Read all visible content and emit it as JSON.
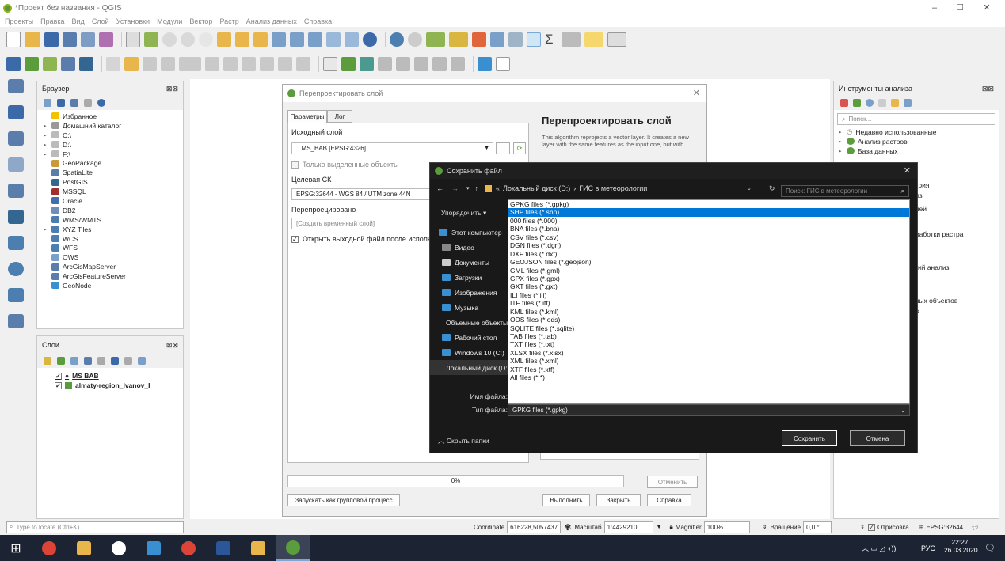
{
  "window": {
    "title": "*Проект без названия - QGIS",
    "min": "–",
    "max": "☐",
    "close": "✕"
  },
  "menu": [
    "Проекты",
    "Правка",
    "Вид",
    "Слой",
    "Установки",
    "Модули",
    "Вектор",
    "Растр",
    "Анализ данных",
    "Справка"
  ],
  "browser": {
    "title": "Браузер",
    "items": [
      {
        "label": "Избранное",
        "icon": "star-icon",
        "color": "#f2c200",
        "arrow": ""
      },
      {
        "label": "Домашний каталог",
        "icon": "home-folder-icon",
        "color": "#999",
        "arrow": "▸"
      },
      {
        "label": "C:\\",
        "icon": "folder-icon",
        "color": "#bbb",
        "arrow": "▸"
      },
      {
        "label": "D:\\",
        "icon": "folder-icon",
        "color": "#bbb",
        "arrow": "▸"
      },
      {
        "label": "F:\\",
        "icon": "folder-icon",
        "color": "#bbb",
        "arrow": "▸"
      },
      {
        "label": "GeoPackage",
        "icon": "geopackage-icon",
        "color": "#c79a3c",
        "arrow": ""
      },
      {
        "label": "SpatiaLite",
        "icon": "spatialite-icon",
        "color": "#5a7dac",
        "arrow": ""
      },
      {
        "label": "PostGIS",
        "icon": "postgis-icon",
        "color": "#336791",
        "arrow": ""
      },
      {
        "label": "MSSQL",
        "icon": "mssql-icon",
        "color": "#a03030",
        "arrow": ""
      },
      {
        "label": "Oracle",
        "icon": "oracle-icon",
        "color": "#3f6fad",
        "arrow": ""
      },
      {
        "label": "DB2",
        "icon": "db2-icon",
        "color": "#6f8fb8",
        "arrow": ""
      },
      {
        "label": "WMS/WMTS",
        "icon": "wms-icon",
        "color": "#4c7fb0",
        "arrow": ""
      },
      {
        "label": "XYZ Tiles",
        "icon": "xyz-icon",
        "color": "#4c7fb0",
        "arrow": "▸"
      },
      {
        "label": "WCS",
        "icon": "wcs-icon",
        "color": "#4c7fb0",
        "arrow": ""
      },
      {
        "label": "WFS",
        "icon": "wfs-icon",
        "color": "#4c7fb0",
        "arrow": ""
      },
      {
        "label": "OWS",
        "icon": "ows-icon",
        "color": "#7a9fc8",
        "arrow": ""
      },
      {
        "label": "ArcGisMapServer",
        "icon": "arcgis-map-icon",
        "color": "#5a7dac",
        "arrow": ""
      },
      {
        "label": "ArcGisFeatureServer",
        "icon": "arcgis-feature-icon",
        "color": "#5a7dac",
        "arrow": ""
      },
      {
        "label": "GeoNode",
        "icon": "geonode-icon",
        "color": "#3a8fd0",
        "arrow": ""
      }
    ]
  },
  "layers": {
    "title": "Слои",
    "items": [
      {
        "label": "MS BAB",
        "checked": "✓"
      },
      {
        "label": "almaty-region_Ivanov_I",
        "checked": "✓"
      }
    ]
  },
  "reproject": {
    "title": "Перепроектировать слой",
    "tabs": [
      "Параметры",
      "Лог"
    ],
    "input_label": "Исходный слой",
    "input_value": "MS_BAB [EPSG:4326]",
    "selected_only": "Только выделенные объекты",
    "target_label": "Целевая СК",
    "target_value": "EPSG:32644 - WGS 84 / UTM zone 44N",
    "output_label": "Перепроецировано",
    "output_value": "[Создать временный слой]",
    "open_after": "Открыть выходной файл после исполнен",
    "help_title": "Перепроектировать слой",
    "help_text": "This algorithm reprojects a vector layer. It creates a new layer with the same features as the input one, but with geometries reprojected to a new CRS.",
    "progress": "0%",
    "cancel": "Отменить",
    "batch": "Запускать как групповой процесс",
    "run": "Выполнить",
    "close": "Закрыть",
    "help": "Справка"
  },
  "save": {
    "title": "Сохранить файл",
    "path_prefix": "«",
    "path_drive": "Локальный диск (D:)",
    "path_folder": "ГИС в метеорологии",
    "search_placeholder": "Поиск: ГИС в метеорологии",
    "organize": "Упорядочить ▾",
    "nav": [
      {
        "label": "Этот компьютер",
        "color": "#3a8fd0"
      },
      {
        "label": "Видео",
        "color": "#888"
      },
      {
        "label": "Документы",
        "color": "#ccc"
      },
      {
        "label": "Загрузки",
        "color": "#3a8fd0"
      },
      {
        "label": "Изображения",
        "color": "#3a8fd0"
      },
      {
        "label": "Музыка",
        "color": "#3a8fd0"
      },
      {
        "label": "Объемные объекты",
        "color": "#3a8fd0"
      },
      {
        "label": "Рабочий стол",
        "color": "#3a8fd0"
      },
      {
        "label": "Windows 10 (C:)",
        "color": "#3a8fd0"
      },
      {
        "label": "Локальный диск (D:)",
        "color": "#888"
      }
    ],
    "filename_label": "Имя файла:",
    "filetype_label": "Тип файла:",
    "filetype_value": "GPKG files (*.gpkg)",
    "save": "Сохранить",
    "cancel": "Отмена",
    "hide": "Скрыть папки",
    "types": [
      "GPKG files (*.gpkg)",
      "SHP files (*.shp)",
      "000 files (*.000)",
      "BNA files (*.bna)",
      "CSV files (*.csv)",
      "DGN files (*.dgn)",
      "DXF files (*.dxf)",
      "GEOJSON files (*.geojson)",
      "GML files (*.gml)",
      "GPX files (*.gpx)",
      "GXT files (*.gxt)",
      "ILI files (*.ili)",
      "ITF files (*.itf)",
      "KML files (*.kml)",
      "ODS files (*.ods)",
      "SQLITE files (*.sqlite)",
      "TAB files (*.tab)",
      "TXT files (*.txt)",
      "XLSX files (*.xlsx)",
      "XML files (*.xml)",
      "XTF files (*.xtf)",
      "All files (*.*)"
    ],
    "selected_type": 1
  },
  "tools": {
    "title": "Инструменты анализа",
    "search_placeholder": "Поиск...",
    "items": [
      "Недавно использованные",
      "Анализ растров",
      "База данных"
    ],
    "partial": [
      "етрия",
      "лиз",
      "олей",
      "бработки растра",
      "ский анализ",
      "рных объектов",
      "ов"
    ]
  },
  "status": {
    "locate": "Type to locate (Ctrl+K)",
    "coord_label": "Coordinate",
    "coord": "616228,5057437",
    "scale_label": "Масштаб",
    "scale": "1:4429210",
    "magnifier_label": "Magnifier",
    "magnifier": "100%",
    "rotation_label": "Вращение",
    "rotation": "0,0 °",
    "render": "Отрисовка",
    "crs": "EPSG:32644"
  },
  "taskbar": {
    "lang": "РУС",
    "time": "22:27",
    "date": "26.03.2020"
  }
}
